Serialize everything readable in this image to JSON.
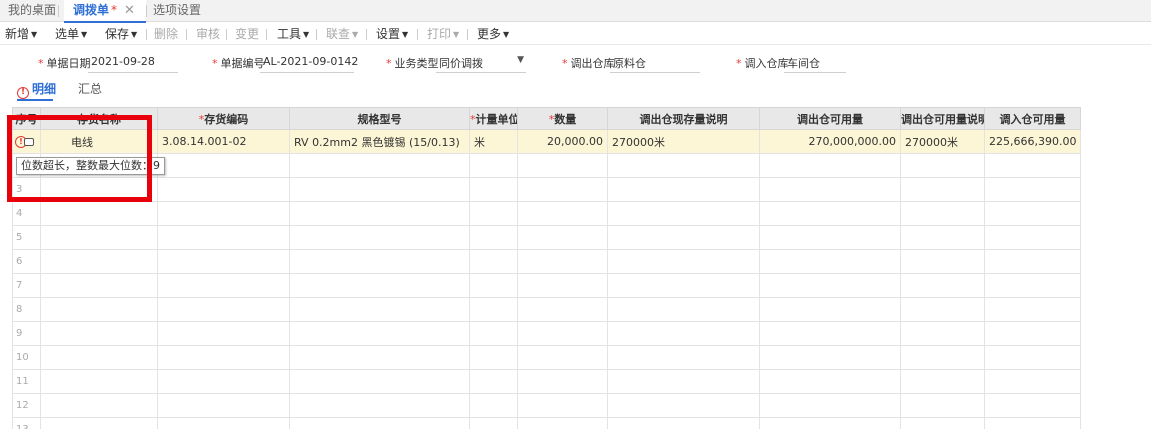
{
  "tabs": {
    "desktop": "我的桌面",
    "transfer": "调拨单",
    "transfer_mark": "*",
    "close_glyph": "✕",
    "options": "选项设置"
  },
  "toolbar": {
    "new": "新增",
    "select": "选单",
    "save": "保存",
    "delete": "删除",
    "audit": "审核",
    "change": "变更",
    "tools": "工具",
    "link": "联查",
    "settings": "设置",
    "print": "打印",
    "more": "更多"
  },
  "form": {
    "required_mark": "*",
    "date_label": "单据日期",
    "date_value": "2021-09-28",
    "code_label": "单据编号",
    "code_value": "AL-2021-09-0142",
    "biztype_label": "业务类型",
    "biztype_value": "同价调拨",
    "out_wh_label": "调出仓库",
    "out_wh_value": "原料仓",
    "in_wh_label": "调入仓库",
    "in_wh_value": "车间仓"
  },
  "detail_tabs": {
    "detail": "明细",
    "summary": "汇总",
    "warn_glyph": "!"
  },
  "grid": {
    "headers": {
      "rownum": "序号",
      "name": "存货名称",
      "code": "存货编码",
      "spec": "规格型号",
      "unit": "计量单位",
      "qty": "数量",
      "out_stock_desc": "调出仓现存量说明",
      "out_avail": "调出仓可用量",
      "out_avail_desc": "调出仓可用量说明",
      "in_avail": "调入仓可用量"
    },
    "row1": {
      "rownum": "1",
      "name": "电线",
      "code": "3.08.14.001-02",
      "spec": "RV  0.2mm2  黑色镀锡 (15/0.13)",
      "unit": "米",
      "qty": "20,000.00",
      "out_stock_desc": "270000米",
      "out_avail": "270,000,000.00",
      "out_avail_desc": "270000米",
      "in_avail": "225,666,390.00"
    },
    "empty_rows": [
      "2",
      "3",
      "4",
      "5",
      "6",
      "7",
      "8",
      "9",
      "10",
      "11",
      "12",
      "13"
    ]
  },
  "tooltip": {
    "text": "位数超长，整数最大位数：9"
  },
  "colors": {
    "accent": "#2f6fd6",
    "error": "#e53935",
    "highlight_box": "#e8000b",
    "selected_row": "#fdf6d6"
  }
}
